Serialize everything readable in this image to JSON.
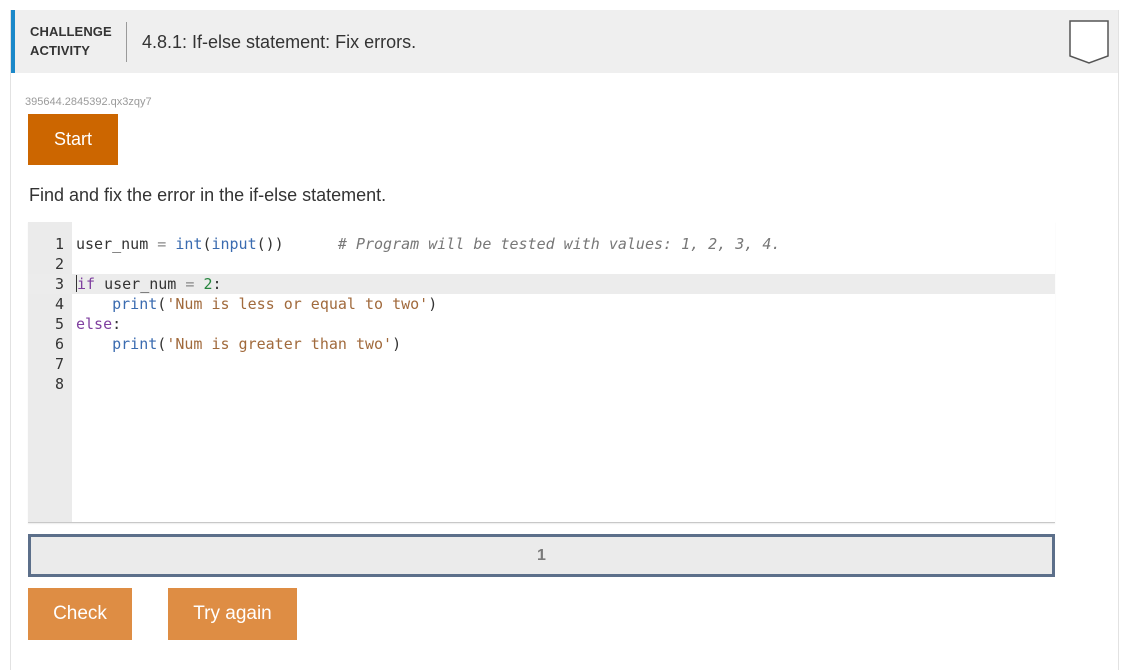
{
  "header": {
    "activity_label_line1": "CHALLENGE",
    "activity_label_line2": "ACTIVITY",
    "title": "4.8.1: If-else statement: Fix errors."
  },
  "activity_id": "395644.2845392.qx3zqy7",
  "start_button": "Start",
  "instructions": "Find and fix the error in the if-else statement.",
  "editor": {
    "line_numbers": [
      "1",
      "2",
      "3",
      "4",
      "5",
      "6",
      "7",
      "8"
    ],
    "lines": [
      {
        "tokens": [
          [
            "plain",
            "user_num "
          ],
          [
            "op",
            "="
          ],
          [
            "plain",
            " "
          ],
          [
            "fn",
            "int"
          ],
          [
            "plain",
            "("
          ],
          [
            "fn",
            "input"
          ],
          [
            "plain",
            "())"
          ],
          [
            "plain",
            "      "
          ],
          [
            "cm",
            "# Program will be tested with values: 1, 2, 3, 4."
          ]
        ]
      },
      {
        "tokens": []
      },
      {
        "tokens": [
          [
            "kw",
            "if"
          ],
          [
            "plain",
            " user_num "
          ],
          [
            "op",
            "="
          ],
          [
            "plain",
            " "
          ],
          [
            "num",
            "2"
          ],
          [
            "plain",
            ":"
          ]
        ],
        "active": true
      },
      {
        "tokens": [
          [
            "plain",
            "    "
          ],
          [
            "fn",
            "print"
          ],
          [
            "plain",
            "("
          ],
          [
            "str",
            "'Num is less or equal to two'"
          ],
          [
            "plain",
            ")"
          ]
        ]
      },
      {
        "tokens": [
          [
            "kw",
            "else"
          ],
          [
            "plain",
            ":"
          ]
        ]
      },
      {
        "tokens": [
          [
            "plain",
            "    "
          ],
          [
            "fn",
            "print"
          ],
          [
            "plain",
            "("
          ],
          [
            "str",
            "'Num is greater than two'"
          ],
          [
            "plain",
            ")"
          ]
        ]
      },
      {
        "tokens": []
      },
      {
        "tokens": []
      }
    ]
  },
  "progress": {
    "segments": [
      "1"
    ]
  },
  "buttons": {
    "check": "Check",
    "try_again": "Try again"
  },
  "colors": {
    "accent_blue": "#1b88c9",
    "start_orange": "#cc6600",
    "action_orange": "#de8d44",
    "progress_border": "#5c6f8a"
  },
  "icons": {
    "badge": "completion-badge-icon"
  }
}
